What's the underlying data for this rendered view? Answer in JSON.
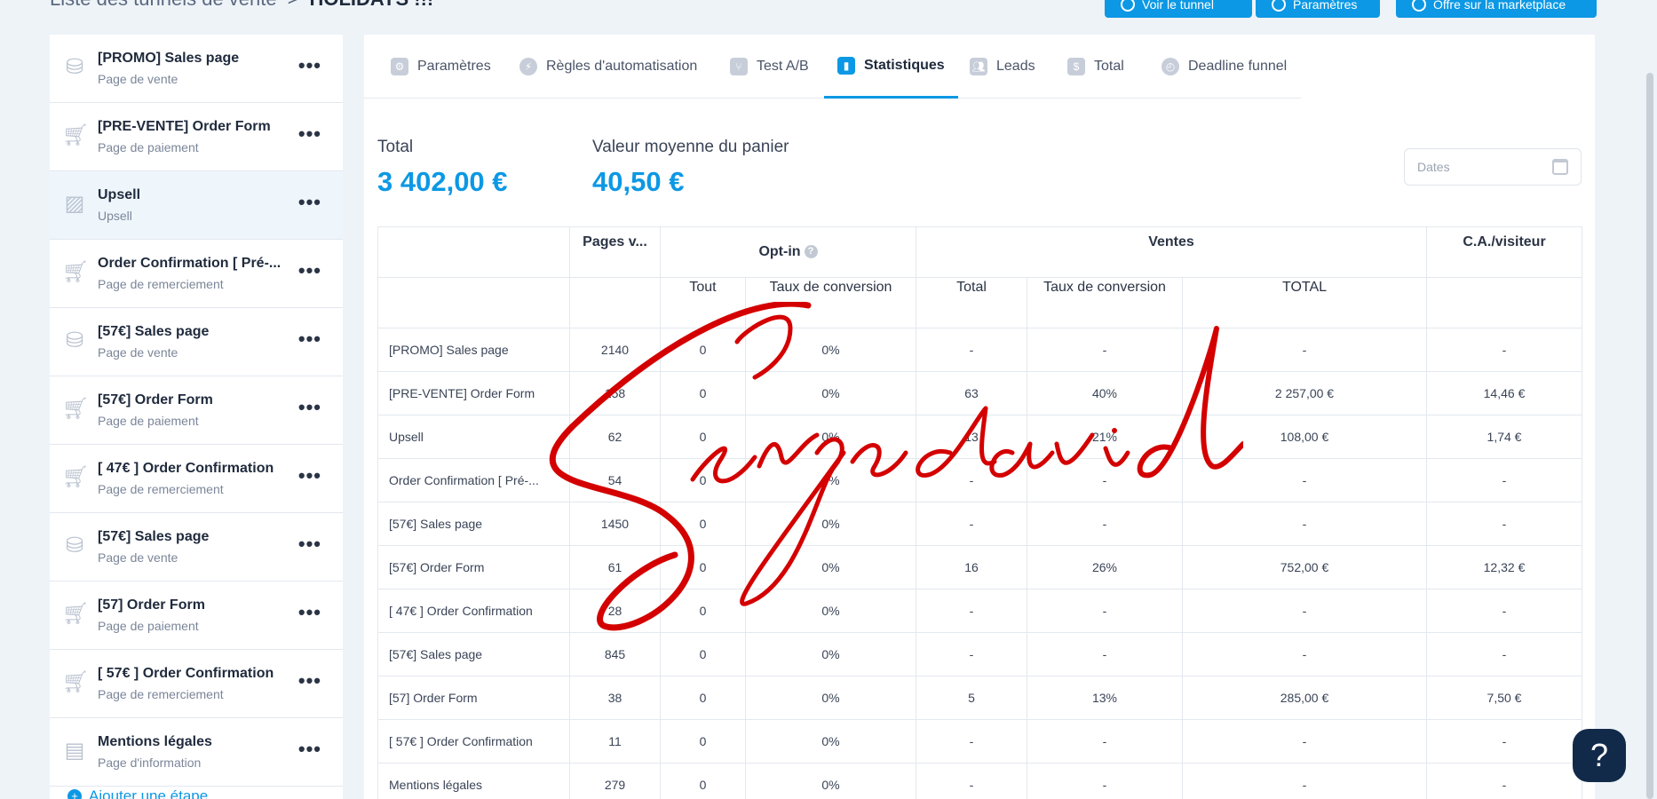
{
  "header": {
    "breadcrumb_root": "Liste des tunnels de vente",
    "separator": ">",
    "current": "HOLIDAYS !!!",
    "buttons": [
      {
        "label": "Voir le tunnel"
      },
      {
        "label": "Paramètres"
      },
      {
        "label": "Offre sur la marketplace"
      }
    ]
  },
  "sidebar": {
    "steps": [
      {
        "title": "[PROMO] Sales page",
        "type": "Page de vente",
        "icon": "coins-icon"
      },
      {
        "title": "[PRE-VENTE] Order Form",
        "type": "Page de paiement",
        "icon": "cart-icon"
      },
      {
        "title": "Upsell",
        "type": "Upsell",
        "icon": "chart-up-icon"
      },
      {
        "title": "Order Confirmation [ Pré-...",
        "type": "Page de remerciement",
        "icon": "cart-check-icon"
      },
      {
        "title": "[57€] Sales page",
        "type": "Page de vente",
        "icon": "coins-icon"
      },
      {
        "title": "[57€] Order Form",
        "type": "Page de paiement",
        "icon": "cart-icon"
      },
      {
        "title": "[ 47€ ] Order Confirmation",
        "type": "Page de remerciement",
        "icon": "cart-check-icon"
      },
      {
        "title": "[57€] Sales page",
        "type": "Page de vente",
        "icon": "coins-icon"
      },
      {
        "title": "[57] Order Form",
        "type": "Page de paiement",
        "icon": "cart-icon"
      },
      {
        "title": "[ 57€ ] Order Confirmation",
        "type": "Page de remerciement",
        "icon": "cart-check-icon"
      },
      {
        "title": "Mentions légales",
        "type": "Page d'information",
        "icon": "info-page-icon"
      }
    ],
    "more_label": "•••",
    "add_step": "Ajouter une étape"
  },
  "tabs": [
    {
      "label": "Paramètres",
      "icon": "settings-icon"
    },
    {
      "label": "Règles d'automatisation",
      "icon": "bolt-icon"
    },
    {
      "label": "Test A/B",
      "icon": "split-icon"
    },
    {
      "label": "Statistiques",
      "icon": "stats-icon",
      "active": true
    },
    {
      "label": "Leads",
      "icon": "users-icon"
    },
    {
      "label": "Total",
      "icon": "dollar-icon"
    },
    {
      "label": "Deadline funnel",
      "icon": "clock-icon"
    }
  ],
  "stats": {
    "total_label": "Total",
    "total_value": "3 402,00 €",
    "avg_label": "Valeur moyenne du panier",
    "avg_value": "40,50 €",
    "date_placeholder": "Dates"
  },
  "table": {
    "headers": {
      "pages": "Pages v...",
      "optin": "Opt-in",
      "sales": "Ventes",
      "ca": "C.A./visiteur",
      "optin_all": "Tout",
      "optin_rate": "Taux de conversion",
      "sales_total": "Total",
      "sales_rate": "Taux de conversion",
      "sales_sum": "TOTAL"
    },
    "rows": [
      [
        "[PROMO] Sales page",
        "2140",
        "0",
        "0%",
        "-",
        "-",
        "-",
        "-"
      ],
      [
        "[PRE-VENTE] Order Form",
        "158",
        "0",
        "0%",
        "63",
        "40%",
        "2 257,00 €",
        "14,46 €"
      ],
      [
        "Upsell",
        "62",
        "0",
        "0%",
        "13",
        "21%",
        "108,00 €",
        "1,74 €"
      ],
      [
        "Order Confirmation [ Pré-...",
        "54",
        "0",
        "0%",
        "-",
        "-",
        "-",
        "-"
      ],
      [
        "[57€] Sales page",
        "1450",
        "0",
        "0%",
        "-",
        "-",
        "-",
        "-"
      ],
      [
        "[57€] Order Form",
        "61",
        "0",
        "0%",
        "16",
        "26%",
        "752,00 €",
        "12,32 €"
      ],
      [
        "[ 47€ ] Order Confirmation",
        "28",
        "0",
        "0%",
        "-",
        "-",
        "-",
        "-"
      ],
      [
        "[57€] Sales page",
        "845",
        "0",
        "0%",
        "-",
        "-",
        "-",
        "-"
      ],
      [
        "[57] Order Form",
        "38",
        "0",
        "0%",
        "5",
        "13%",
        "285,00 €",
        "7,50 €"
      ],
      [
        "[ 57€ ] Order Confirmation",
        "11",
        "0",
        "0%",
        "-",
        "-",
        "-",
        "-"
      ],
      [
        "Mentions légales",
        "279",
        "0",
        "0%",
        "-",
        "-",
        "-",
        "-"
      ]
    ]
  },
  "signature_text": "Serge david",
  "help_label": "?",
  "colors": {
    "accent": "#0c98e4",
    "signature": "#d40000",
    "help": "#122a4a"
  }
}
